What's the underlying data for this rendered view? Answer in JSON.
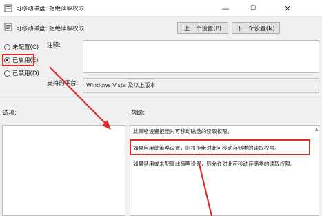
{
  "window": {
    "title": "可移动磁盘: 拒绝读取权限",
    "controls": {
      "minimize": "—",
      "maximize": "☐",
      "close": "✕"
    }
  },
  "setting": {
    "name": "可移动磁盘: 拒绝读取权限"
  },
  "nav": {
    "prev_label": "上一个设置(P)",
    "next_label": "下一个设置(N)"
  },
  "radios": [
    {
      "label": "未配置(C)",
      "selected": false
    },
    {
      "label": "已启用(E)",
      "selected": true
    },
    {
      "label": "已禁用(D)",
      "selected": false
    }
  ],
  "comment": {
    "label": "注释:",
    "value": ""
  },
  "supported": {
    "label": "支持的平台:",
    "value": "Windows Vista 及以上版本"
  },
  "options": {
    "label": "选项:"
  },
  "help": {
    "label": "帮助:",
    "lines": [
      "此策略设置拒绝对可移动磁盘的读取权限。",
      "如果启用此策略设置，则将拒绝对此可移动存储类的读取权限。",
      "如果禁用或未配置此策略设置，则允许对此可移动存储类的读取权限。"
    ]
  },
  "colors": {
    "annotation": "#e02b2b",
    "panel": "#f0f0f0"
  }
}
